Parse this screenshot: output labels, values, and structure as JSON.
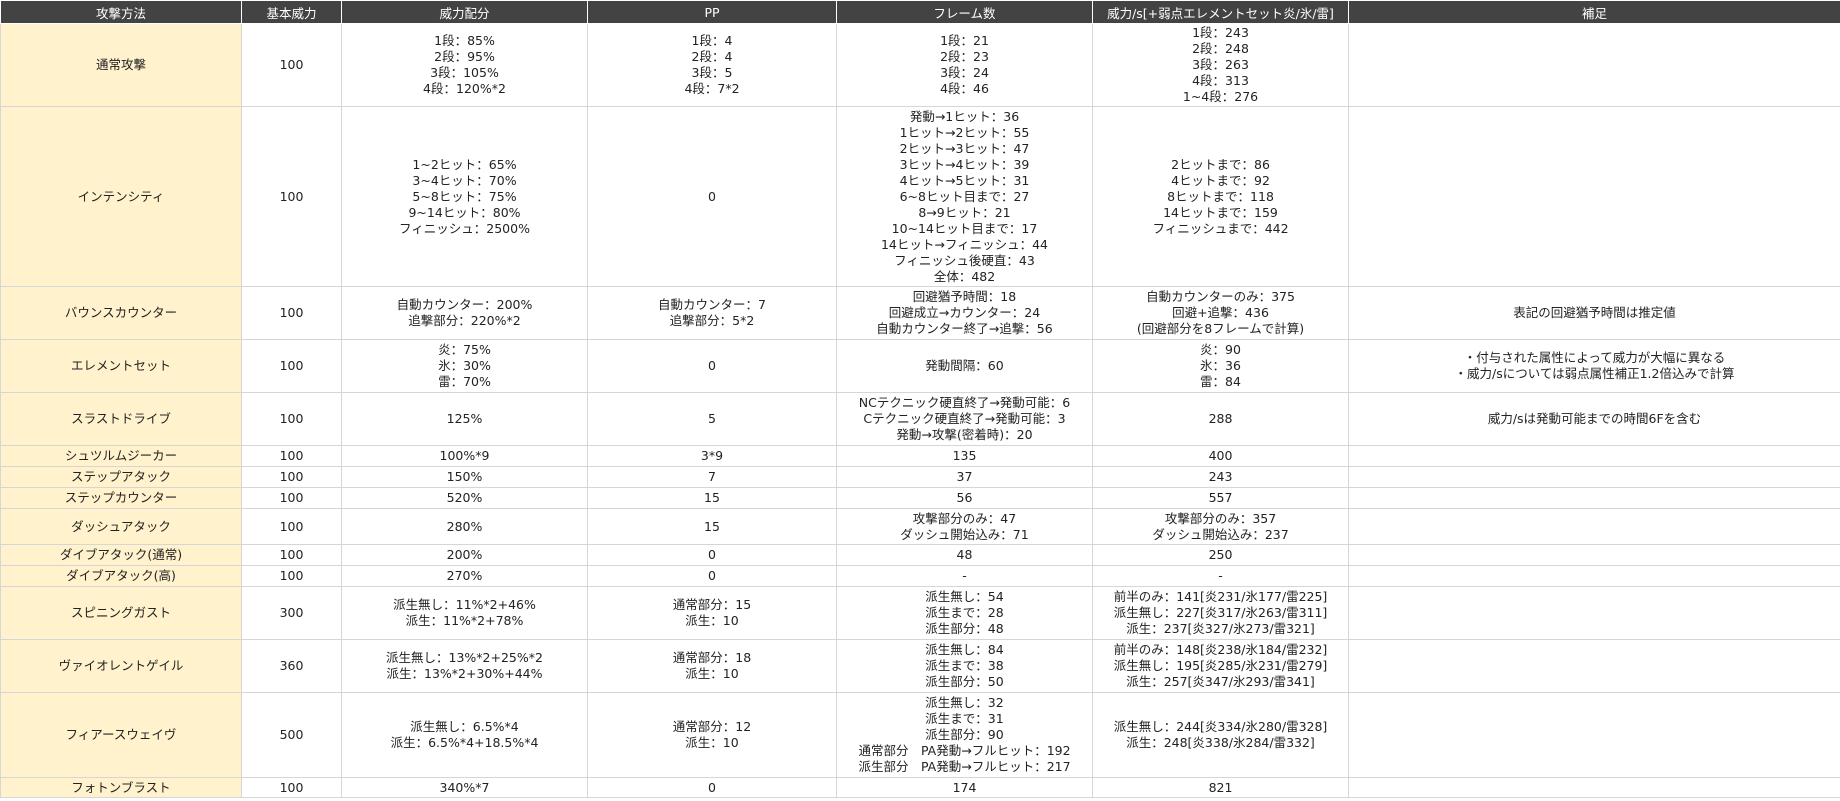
{
  "header": [
    "攻撃方法",
    "基本威力",
    "威力配分",
    "PP",
    "フレーム数",
    "威力/s[+弱点エレメントセット炎/氷/雷]",
    "補足"
  ],
  "rows": [
    {
      "h": 83,
      "cells": [
        "通常攻撃",
        "100",
        "1段：85%\n2段：95%\n3段：105%\n4段：120%*2",
        "1段：4\n2段：4\n3段：5\n4段：7*2",
        "1段：21\n2段：23\n3段：24\n4段：46",
        "1段：243\n2段：248\n3段：263\n4段：313\n1~4段：276",
        ""
      ]
    },
    {
      "h": 180,
      "cells": [
        "インテンシティ",
        "100",
        "1~2ヒット：65%\n3~4ヒット：70%\n5~8ヒット：75%\n9~14ヒット：80%\nフィニッシュ：2500%",
        "0",
        "発動→1ヒット：36\n1ヒット→2ヒット：55\n2ヒット→3ヒット：47\n3ヒット→4ヒット：39\n4ヒット→5ヒット：31\n6~8ヒット目まで：27\n8→9ヒット：21\n10~14ヒット目まで：17\n14ヒット→フィニッシュ：44\nフィニッシュ後硬直：43\n全体：482",
        "2ヒットまで：86\n4ヒットまで：92\n8ヒットまで：118\n14ヒットまで：159\nフィニッシュまで：442",
        ""
      ]
    },
    {
      "h": 53,
      "cells": [
        "バウンスカウンター",
        "100",
        "自動カウンター：200%\n追撃部分：220%*2",
        "自動カウンター：7\n追撃部分：5*2",
        "回避猶予時間：18\n回避成立→カウンター：24\n自動カウンター終了→追撃：56",
        "自動カウンターのみ：375\n回避+追撃：436\n(回避部分を8フレームで計算)",
        "表記の回避猶予時間は推定値"
      ]
    },
    {
      "h": 53,
      "cells": [
        "エレメントセット",
        "100",
        "炎：75%\n氷：30%\n雷：70%",
        "0",
        "発動間隔：60",
        "炎：90\n氷：36\n雷：84",
        "・付与された属性によって威力が大幅に異なる\n・威力/sについては弱点属性補正1.2倍込みで計算"
      ]
    },
    {
      "h": 53,
      "cells": [
        "スラストドライブ",
        "100",
        "125%",
        "5",
        "NCテクニック硬直終了→発動可能：6\nCテクニック硬直終了→発動可能：3\n発動→攻撃(密着時)：20",
        "288",
        "威力/sは発動可能までの時間6Fを含む"
      ]
    },
    {
      "h": 21,
      "cells": [
        "シュツルムジーカー",
        "100",
        "100%*9",
        "3*9",
        "135",
        "400",
        ""
      ]
    },
    {
      "h": 21,
      "cells": [
        "ステップアタック",
        "100",
        "150%",
        "7",
        "37",
        "243",
        ""
      ]
    },
    {
      "h": 21,
      "cells": [
        "ステップカウンター",
        "100",
        "520%",
        "15",
        "56",
        "557",
        ""
      ]
    },
    {
      "h": 36,
      "cells": [
        "ダッシュアタック",
        "100",
        "280%",
        "15",
        "攻撃部分のみ：47\nダッシュ開始込み：71",
        "攻撃部分のみ：357\nダッシュ開始込み：237",
        ""
      ]
    },
    {
      "h": 21,
      "cells": [
        "ダイブアタック(通常)",
        "100",
        "200%",
        "0",
        "48",
        "250",
        ""
      ]
    },
    {
      "h": 21,
      "cells": [
        "ダイブアタック(高)",
        "100",
        "270%",
        "0",
        "-",
        "-",
        ""
      ]
    },
    {
      "h": 53,
      "cells": [
        "スピニングガスト",
        "300",
        "派生無し：11%*2+46%\n派生：11%*2+78%",
        "通常部分：15\n派生：10",
        "派生無し：54\n派生まで：28\n派生部分：48",
        "前半のみ：141[炎231/氷177/雷225]\n派生無し：227[炎317/氷263/雷311]\n派生：237[炎327/氷273/雷321]",
        ""
      ]
    },
    {
      "h": 53,
      "cells": [
        "ヴァイオレントゲイル",
        "360",
        "派生無し：13%*2+25%*2\n派生：13%*2+30%+44%",
        "通常部分：18\n派生：10",
        "派生無し：84\n派生まで：38\n派生部分：50",
        "前半のみ：148[炎238/氷184/雷232]\n派生無し：195[炎285/氷231/雷279]\n派生：257[炎347/氷293/雷341]",
        ""
      ]
    },
    {
      "h": 85,
      "cells": [
        "フィアースウェイヴ",
        "500",
        "派生無し：6.5%*4\n派生：6.5%*4+18.5%*4",
        "通常部分：12\n派生：10",
        "派生無し：32\n派生まで：31\n派生部分：90\n通常部分　PA発動→フルヒット：192\n派生部分　PA発動→フルヒット：217",
        "派生無し：244[炎334/氷280/雷328]\n派生：248[炎338/氷284/雷332]",
        ""
      ]
    },
    {
      "h": 20,
      "cells": [
        "フォトンブラスト",
        "100",
        "340%*7",
        "0",
        "174",
        "821",
        ""
      ]
    }
  ]
}
